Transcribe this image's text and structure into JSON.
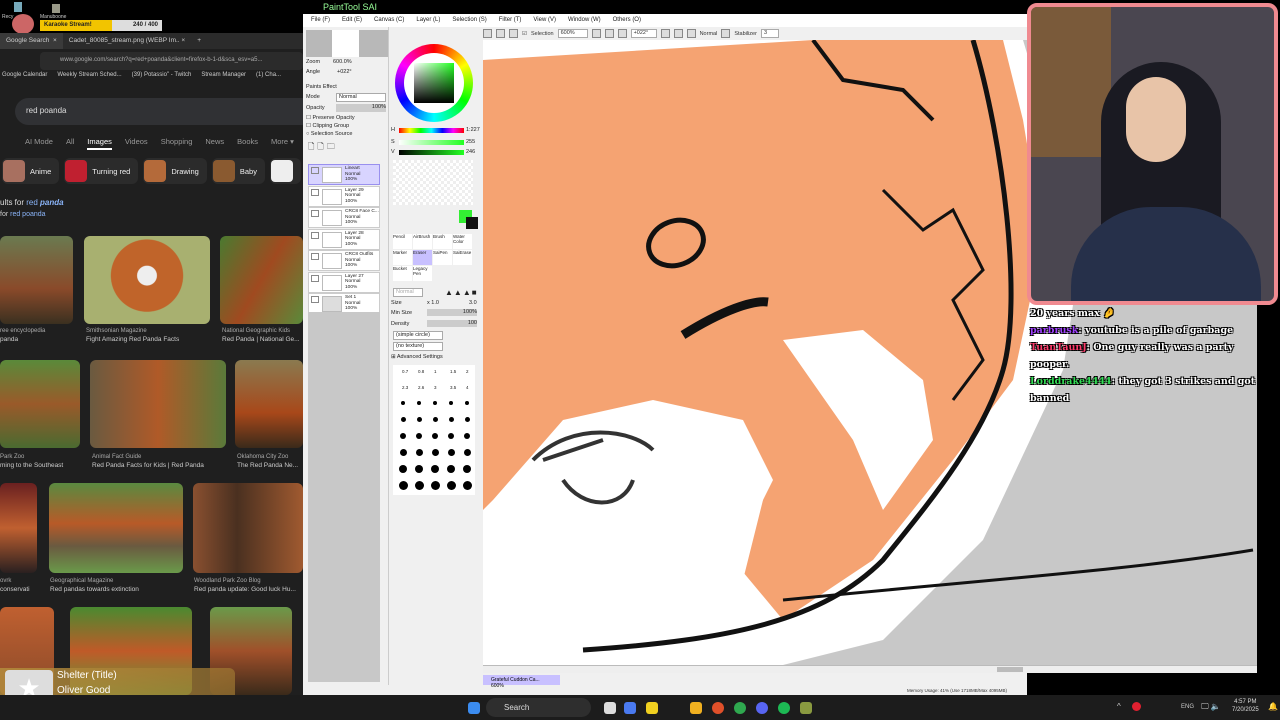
{
  "desktop": {
    "icons": [
      "Recy",
      "Manuboone"
    ],
    "karaoke": {
      "label": "Karaoke Stream!",
      "progress_text": "240 / 400",
      "progress": 0.6
    }
  },
  "browser": {
    "tabs": [
      {
        "label": "Google Search",
        "close": "×"
      },
      {
        "label": "Cadet_80085_stream.png (WEBP Im..",
        "close": "×"
      },
      {
        "label": "+"
      }
    ],
    "url": "www.google.com/search?q=red+poanda&client=firefox-b-1-d&sca_esv=a5...",
    "bookmarks": [
      "Google Calendar",
      "Weekly Stream Sched...",
      "(39) Potassio\" - Twitch",
      "Stream Manager",
      "(1) Cha..."
    ],
    "search_query": "red poanda",
    "search_tabs": [
      "AI Mode",
      "All",
      "Images",
      "Videos",
      "Shopping",
      "News",
      "Books",
      "More ▾"
    ],
    "chips": [
      "Anime",
      "Turning red",
      "Drawing",
      "Baby"
    ],
    "results_for_prefix": "ults for ",
    "results_for_1": "red ",
    "results_for_2": "panda",
    "search_instead_prefix": "for ",
    "search_instead": "red poanda",
    "captions": [
      {
        "src": "ree encyclopedia",
        "title": "panda"
      },
      {
        "src": "Smithsonian Magazine",
        "title": "Fight Amazing Red Panda Facts"
      },
      {
        "src": "National Geographic Kids",
        "title": "Red Panda | National Ge..."
      },
      {
        "src": "Park Zoo",
        "title": "ming to the Southeast"
      },
      {
        "src": "Animal Fact Guide",
        "title": "Red Panda Facts for Kids | Red Panda"
      },
      {
        "src": "Oklahoma City Zoo",
        "title": "The Red Panda Ne..."
      },
      {
        "src": "ovrk",
        "title": "conservati"
      },
      {
        "src": "Geographical Magazine",
        "title": "Red pandas towards extinction"
      },
      {
        "src": "Woodland Park Zoo Blog",
        "title": "Red panda update: Good luck Hu..."
      }
    ]
  },
  "sai": {
    "title": "PaintTool SAI",
    "menu": [
      "File (F)",
      "Edit (E)",
      "Canvas (C)",
      "Layer (L)",
      "Selection (S)",
      "Filter (T)",
      "View (V)",
      "Window (W)",
      "Others (O)"
    ],
    "toolbar": {
      "selection_label": "Selection",
      "zoom": "600%",
      "angle": "+022°",
      "blend": "Normal",
      "stabilizer_label": "Stabilizer",
      "stabilizer": "3"
    },
    "navigator": {
      "zoom_label": "Zoom",
      "zoom": "600.0%",
      "angle_label": "Angle",
      "angle": "+022°"
    },
    "layer_props": {
      "paints_effect": "Paints Effect",
      "mode_label": "Mode",
      "mode": "Normal",
      "opacity_label": "Opacity",
      "opacity": "100%",
      "preserve": "Preserve Opacity",
      "clipping": "Clipping Group",
      "selsource": "Selection Source"
    },
    "layers": [
      {
        "name": "Lineart",
        "mode": "Normal",
        "opacity": "100%"
      },
      {
        "name": "Layer 29",
        "mode": "Normal",
        "opacity": "100%"
      },
      {
        "name": "CRC8 Face C...",
        "mode": "Normal",
        "opacity": "100%"
      },
      {
        "name": "Layer 28",
        "mode": "Normal",
        "opacity": "100%"
      },
      {
        "name": "CRC8 Outfits",
        "mode": "Normal",
        "opacity": "100%"
      },
      {
        "name": "Layer 27",
        "mode": "Normal",
        "opacity": "100%"
      },
      {
        "name": "Set 1",
        "mode": "Normal",
        "opacity": "100%"
      }
    ],
    "color": {
      "h_label": "H",
      "h": "1:227",
      "s_label": "S",
      "s": "255",
      "v_label": "V",
      "v": "246",
      "primary": "#33ee33",
      "secondary": "#111111"
    },
    "tools": [
      "Pencil",
      "AirBrush",
      "Brush",
      "Water Color",
      "Marker",
      "Eraser",
      "SaiPen",
      "SaiErase",
      "Bucket",
      "Legacy Pen"
    ],
    "brush": {
      "mode": "Normal",
      "size_label": "Size",
      "size_mult": "x 1.0",
      "size": "3.0",
      "minsize_label": "Min Size",
      "minsize": "100%",
      "density_label": "Density",
      "density": "100",
      "shape": "(simple circle)",
      "texture": "(no texture)",
      "advanced": "Advanced Settings"
    },
    "size_presets": [
      "0.7",
      "0.8",
      "1",
      "1.5",
      "2",
      "2.3",
      "2.6",
      "3",
      "3.5",
      "4"
    ],
    "doc_tab": {
      "name": "Grateful Cuddon Ca...",
      "zoom": "600%"
    },
    "memory": "Memory Usage: 41% (Use 1718MB/Max 4095MB)"
  },
  "chat": [
    {
      "user": "",
      "color": "#ffffff",
      "text": "20 years max 🤌"
    },
    {
      "user": "parbrusk",
      "color": "#a040ff",
      "text": "youtube is a pile of garbage"
    },
    {
      "user": "TuanTaunJ",
      "color": "#ff3b6b",
      "text": "One guy really was a party pooper."
    },
    {
      "user": "Lorddrake4444",
      "color": "#33dd55",
      "text": "they got 3 strikes and got banned"
    }
  ],
  "music": {
    "title": "Shelter (Title)",
    "artist": "Oliver Good"
  },
  "taskbar": {
    "search": "Search",
    "lang": "ENG",
    "time": "4:57 PM",
    "date": "7/20/2025",
    "tray_up": "^"
  }
}
